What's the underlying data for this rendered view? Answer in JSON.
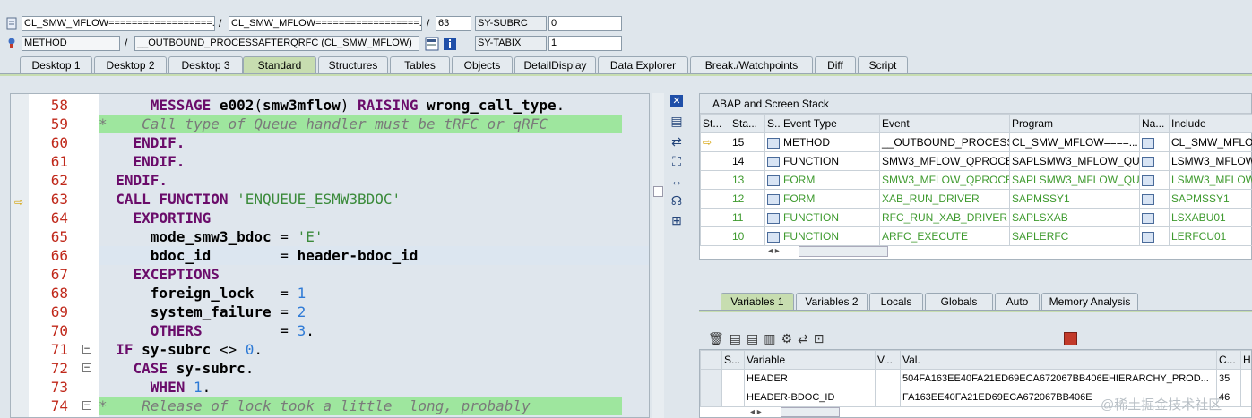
{
  "header": {
    "row1": {
      "field1": "CL_SMW_MFLOW==================...",
      "sep1": "/",
      "field2": "CL_SMW_MFLOW==================...",
      "sep2": "/",
      "line": "63",
      "sysvar_label": "SY-SUBRC",
      "sysvar_value": "0"
    },
    "row2": {
      "type": "METHOD",
      "sep": "/",
      "name": "__OUTBOUND_PROCESSAFTERQRFC (CL_SMW_MFLOW)",
      "sysvar_label": "SY-TABIX",
      "sysvar_value": "1"
    }
  },
  "tabs": [
    "Desktop 1",
    "Desktop 2",
    "Desktop 3",
    "Standard",
    "Structures",
    "Tables",
    "Objects",
    "DetailDisplay",
    "Data Explorer",
    "Break./Watchpoints",
    "Diff",
    "Script"
  ],
  "active_tab": "Standard",
  "code_lines": [
    {
      "n": "58",
      "t": "MESSAGE e002(smw3mflow) RAISING wrong_call_type."
    },
    {
      "n": "59",
      "t": "*    Call type of Queue handler must be tRFC or qRFC"
    },
    {
      "n": "60",
      "t": "ENDIF."
    },
    {
      "n": "61",
      "t": "ENDIF."
    },
    {
      "n": "62",
      "t": "ENDIF."
    },
    {
      "n": "63",
      "t": "CALL FUNCTION 'ENQUEUE_ESMW3BDOC'"
    },
    {
      "n": "64",
      "t": "EXPORTING"
    },
    {
      "n": "65",
      "t": "mode_smw3_bdoc = 'E'"
    },
    {
      "n": "66",
      "t": "bdoc_id        = header-bdoc_id"
    },
    {
      "n": "67",
      "t": "EXCEPTIONS"
    },
    {
      "n": "68",
      "t": "foreign_lock   = 1"
    },
    {
      "n": "69",
      "t": "system_failure = 2"
    },
    {
      "n": "70",
      "t": "OTHERS         = 3."
    },
    {
      "n": "71",
      "t": "IF sy-subrc <> 0."
    },
    {
      "n": "72",
      "t": "CASE sy-subrc."
    },
    {
      "n": "73",
      "t": "WHEN 1."
    },
    {
      "n": "74",
      "t": "*    Release of lock took a little  long, probably"
    }
  ],
  "stack": {
    "title": "ABAP and Screen Stack",
    "columns": [
      "St...",
      "Sta...",
      "S...",
      "Event Type",
      "Event",
      "Program",
      "Na...",
      "Include"
    ],
    "rows": [
      {
        "level": "15",
        "etype": "METHOD",
        "event": "__OUTBOUND_PROCESS...",
        "program": "CL_SMW_MFLOW====...",
        "include": "CL_SMW_MFLOW"
      },
      {
        "level": "14",
        "etype": "FUNCTION",
        "event": "SMW3_MFLOW_QPROCE...",
        "program": "SAPLSMW3_MFLOW_QU...",
        "include": "LSMW3_MFLOW_"
      },
      {
        "level": "13",
        "etype": "FORM",
        "event": "SMW3_MFLOW_QPROCE...",
        "program": "SAPLSMW3_MFLOW_QU...",
        "include": "LSMW3_MFLOW_"
      },
      {
        "level": "12",
        "etype": "FORM",
        "event": "XAB_RUN_DRIVER",
        "program": "SAPMSSY1",
        "include": "SAPMSSY1"
      },
      {
        "level": "11",
        "etype": "FUNCTION",
        "event": "RFC_RUN_XAB_DRIVER",
        "program": "SAPLSXAB",
        "include": "LSXABU01"
      },
      {
        "level": "10",
        "etype": "FUNCTION",
        "event": "ARFC_EXECUTE",
        "program": "SAPLERFC",
        "include": "LERFCU01"
      }
    ]
  },
  "var_tabs": [
    "Variables 1",
    "Variables 2",
    "Locals",
    "Globals",
    "Auto",
    "Memory Analysis"
  ],
  "vars": {
    "columns": [
      "S...",
      "Variable",
      "V...",
      "Val.",
      "C...",
      "He"
    ],
    "rows": [
      {
        "name": "HEADER",
        "value": "504FA163EE40FA21ED69ECA672067BB406EHIERARCHY_PROD...",
        "c": "35"
      },
      {
        "name": "HEADER-BDOC_ID",
        "value": "FA163EE40FA21ED69ECA672067BB406E",
        "c": "46"
      }
    ]
  },
  "watermark": "@稀土掘金技术社区",
  "colors": {
    "active_tab": "#c7ddb0",
    "comment_bg": "#9ee69e",
    "keyword": "#6a0c6a",
    "line_number": "#c0291b"
  }
}
